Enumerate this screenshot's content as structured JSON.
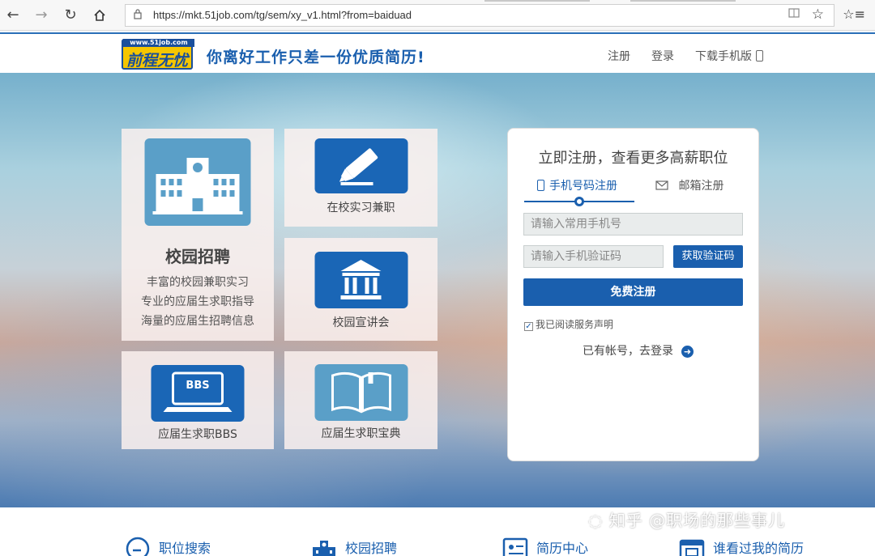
{
  "browser": {
    "url": "https://mkt.51job.com/tg/sem/xy_v1.html?from=baiduad"
  },
  "header": {
    "logo_domain": "www.51job.com",
    "logo_name": "前程无忧",
    "slogan": "你离好工作只差一份优质简历!",
    "links": [
      "注册",
      "登录",
      "下载手机版"
    ]
  },
  "tiles": {
    "campus": {
      "title": "校园招聘",
      "desc": [
        "丰富的校园兼职实习",
        "专业的应届生求职指导",
        "海量的应届生招聘信息"
      ]
    },
    "intern": "在校实习兼职",
    "seminar": "校园宣讲会",
    "bbs": "应届生求职BBS",
    "bbs_screen": "BBS",
    "guide": "应届生求职宝典"
  },
  "register": {
    "title": "立即注册，查看更多高薪职位",
    "tab_phone": "手机号码注册",
    "tab_mail": "邮箱注册",
    "phone_placeholder": "请输入常用手机号",
    "code_placeholder": "请输入手机验证码",
    "code_button": "获取验证码",
    "submit": "免费注册",
    "agree": "我已阅读服务声明",
    "login": "已有帐号，去登录"
  },
  "bottom_nav": [
    "职位搜索",
    "校园招聘",
    "简历中心",
    "谁看过我的简历"
  ],
  "watermark": "知乎 @职场的那些事儿",
  "colors": {
    "brand_blue": "#1a5fae",
    "logo_yellow": "#f6c600",
    "tile_icon_blue": "#1a66b6",
    "tile_icon_light": "#5a9fc8"
  }
}
